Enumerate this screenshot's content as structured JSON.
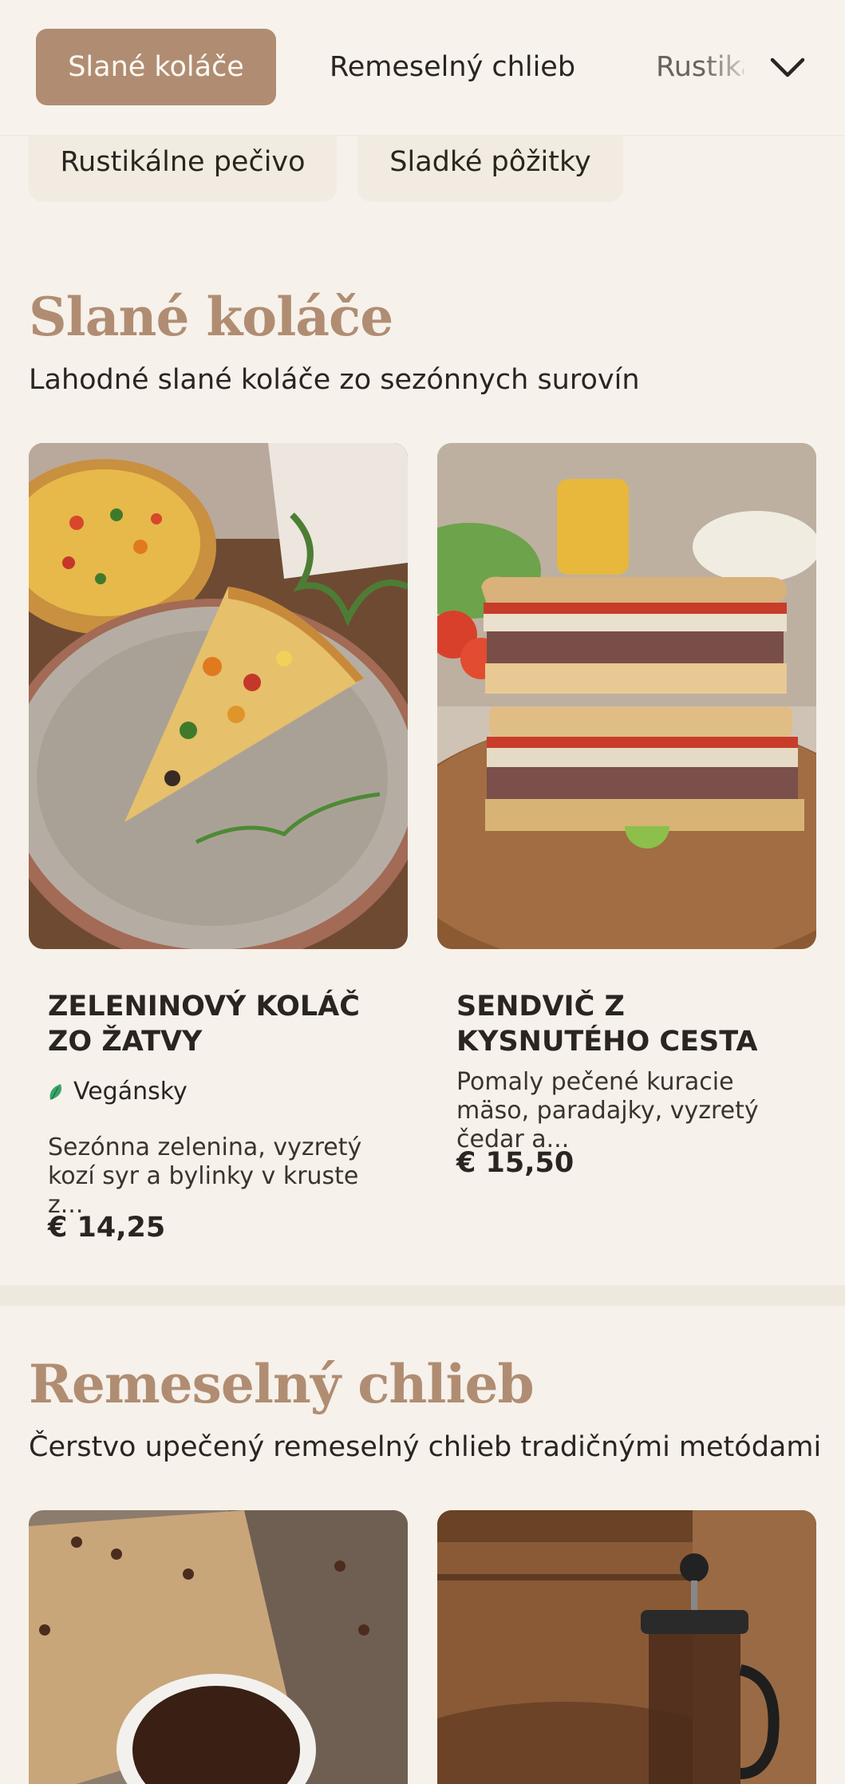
{
  "tabs": [
    {
      "label": "Slané koláče",
      "active": true
    },
    {
      "label": "Remeselný chlieb",
      "active": false
    },
    {
      "label": "Rustikálne pečivo",
      "active": false
    }
  ],
  "chips": [
    {
      "label": "Rustikálne pečivo"
    },
    {
      "label": "Sladké pôžitky"
    }
  ],
  "icons": {
    "expand": "chevron-down-icon",
    "vegan": "leaf-icon"
  },
  "colors": {
    "accent": "#b08d72",
    "background": "#f6f1ea",
    "vegan": "#3aa46a"
  },
  "sections": [
    {
      "title": "Slané koláče",
      "subtitle": "Lahodné slané koláče zo sezónnych surovín",
      "items": [
        {
          "name": "ZELENINOVÝ KOLÁČ ZO ŽATVY",
          "badge": "Vegánsky",
          "description": "Sezónna zelenina, vyzretý kozí syr a bylinky v kruste z...",
          "price": "€ 14,25"
        },
        {
          "name": "SENDVIČ Z KYSNUTÉHO CESTA",
          "description": "Pomaly pečené kuracie mäso, paradajky, vyzretý čedar a...",
          "price": "€ 15,50"
        }
      ]
    },
    {
      "title": "Remeselný chlieb",
      "subtitle": "Čerstvo upečený remeselný chlieb tradičnými metódami"
    }
  ]
}
